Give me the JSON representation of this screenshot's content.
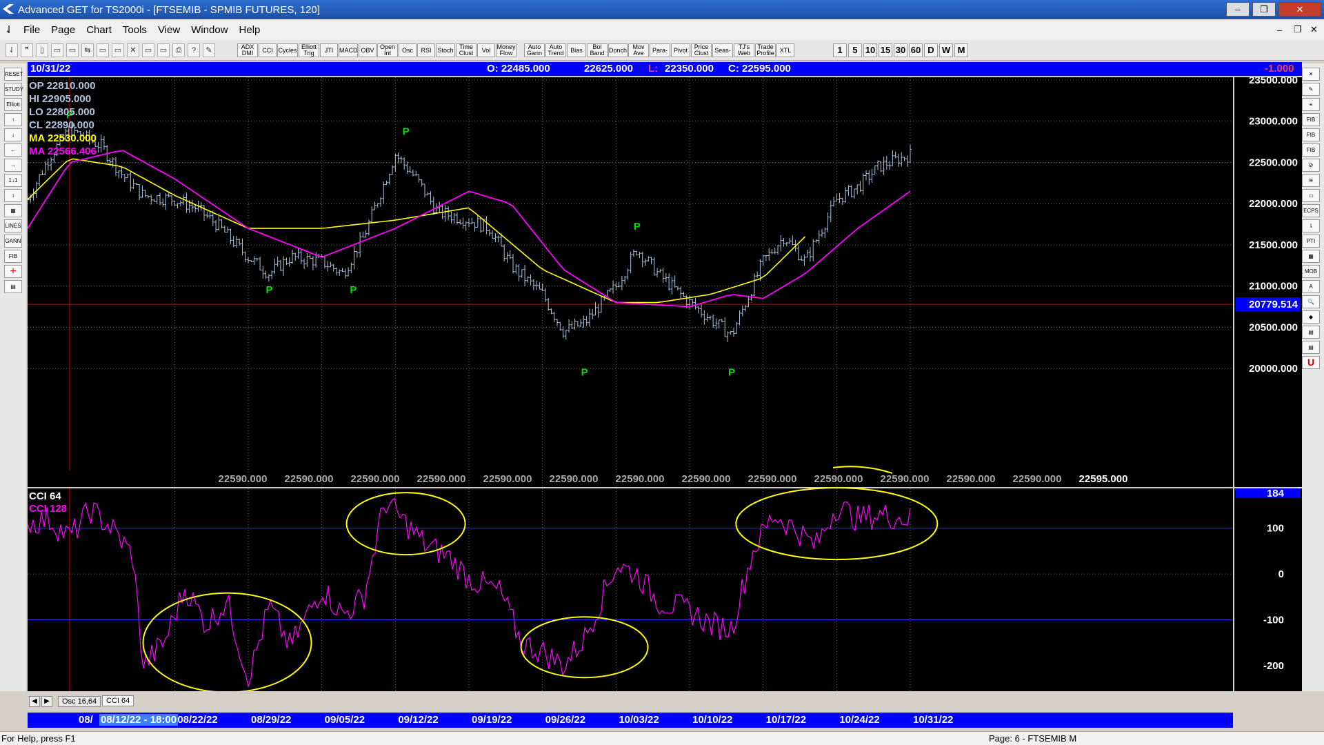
{
  "window": {
    "title": "Advanced GET for TS2000i - [FTSEMIB - SPMIB FUTURES, 120]",
    "controls": [
      "‒",
      "❐",
      "✕"
    ]
  },
  "menu": [
    "File",
    "Page",
    "Chart",
    "Tools",
    "View",
    "Window",
    "Help"
  ],
  "toolbar": {
    "indicators": [
      "ADX DMI",
      "CCI",
      "Cycles",
      "Elliott Trig",
      "JTI",
      "MACD",
      "OBV",
      "Open Int",
      "Osc",
      "RSI",
      "Stoch",
      "Time Clust",
      "Vol",
      "Money Flow",
      "Auto Gann",
      "Auto Trend",
      "Bias",
      "Bol Band",
      "Donch",
      "Mov Ave",
      "Para-bolic",
      "Pivot",
      "Price Clust",
      "Seas-onals",
      "TJ's Web",
      "Trade Profile",
      "XTL"
    ],
    "intervals": [
      "1",
      "5",
      "10",
      "15",
      "30",
      "60",
      "D",
      "W",
      "M"
    ]
  },
  "left_tools": [
    "RESET",
    "STUDY",
    "Elliott",
    "↑",
    "↓",
    "←",
    "→",
    "1↓1",
    "↕",
    "▦",
    "LINES",
    "GANN",
    "FIB",
    "+",
    "▤"
  ],
  "right_tools": [
    "✕",
    "✎",
    "≡",
    "FIB RET",
    "FIB EXT",
    "FIB TIME",
    "⊘",
    "≋",
    "▭",
    "ECPS",
    "⇂",
    "PTI",
    "▦",
    "MOB",
    "A",
    "🔍",
    "◆",
    "▤",
    "▤",
    "U"
  ],
  "info_bar": {
    "date": "10/31/22",
    "open": "O: 22485.000",
    "high": "22625.000",
    "low_label": "L:",
    "low": "22350.000",
    "close": "C: 22595.000",
    "change": "-1.000"
  },
  "legend": {
    "op": "OP 22810.000",
    "hi": "HI   22905.000",
    "lo": "LO  22805.000",
    "cl": "CL  22890.000",
    "ma": "MA  22530.000",
    "ma2": "MA  22566.406"
  },
  "price_axis": {
    "ticks": [
      "23500.000",
      "23000.000",
      "22500.000",
      "22000.000",
      "21500.000",
      "21000.000",
      "20500.000",
      "20000.000"
    ],
    "cursor_value": "20779.514",
    "row_values": [
      "22590.000",
      "22590.000",
      "22590.000",
      "22590.000",
      "22590.000",
      "22590.000",
      "22590.000",
      "22590.000",
      "22590.000",
      "22590.000",
      "22590.000",
      "22590.000",
      "22590.000",
      "22595.000"
    ]
  },
  "cci_panel": {
    "label1": "CCI 64",
    "label2": "CCI  128",
    "ticks": [
      "184",
      "100",
      "0",
      "-100",
      "-200"
    ]
  },
  "tabs": [
    "◀",
    "▶",
    "Osc 16,64",
    "CCI 64"
  ],
  "date_axis": {
    "cursor": "08/12/22 - 18:00",
    "dates": [
      "08/",
      "08/22/22",
      "08/29/22",
      "09/05/22",
      "09/12/22",
      "09/19/22",
      "09/26/22",
      "10/03/22",
      "10/10/22",
      "10/17/22",
      "10/24/22",
      "10/31/22"
    ]
  },
  "status": {
    "help": "For Help, press F1",
    "page": "Page: 6 - FTSEMIB M"
  },
  "colors": {
    "background": "#000000",
    "bars": "#b0c4de",
    "ma_yellow": "#ffff00",
    "ma_magenta": "#ff00ff",
    "pivot_green": "#00dd00",
    "info_blue": "#0000ff",
    "cci_line": "#ff00ff",
    "annotation": "#ffff00"
  },
  "chart_data": {
    "type": "candlestick",
    "timeframe": "120",
    "symbol": "FTSEMIB - SPMIB FUTURES",
    "y_range": [
      19600,
      23500
    ],
    "x_range": [
      "08/08/22",
      "10/31/22"
    ],
    "price_path": [
      [
        "08/08/22",
        22050
      ],
      [
        "08/10/22",
        22550
      ],
      [
        "08/12/22",
        22900
      ],
      [
        "08/15/22",
        22700
      ],
      [
        "08/17/22",
        22350
      ],
      [
        "08/19/22",
        22100
      ],
      [
        "08/22/22",
        22050
      ],
      [
        "08/24/22",
        21950
      ],
      [
        "08/26/22",
        21750
      ],
      [
        "08/29/22",
        21350
      ],
      [
        "08/31/22",
        21150
      ],
      [
        "09/02/22",
        21350
      ],
      [
        "09/05/22",
        21300
      ],
      [
        "09/07/22",
        21150
      ],
      [
        "09/09/22",
        21600
      ],
      [
        "09/12/22",
        22600
      ],
      [
        "09/14/22",
        22300
      ],
      [
        "09/16/22",
        21900
      ],
      [
        "09/19/22",
        21800
      ],
      [
        "09/21/22",
        21700
      ],
      [
        "09/23/22",
        21250
      ],
      [
        "09/26/22",
        20900
      ],
      [
        "09/28/22",
        20450
      ],
      [
        "09/30/22",
        20550
      ],
      [
        "10/03/22",
        21000
      ],
      [
        "10/05/22",
        21450
      ],
      [
        "10/07/22",
        21150
      ],
      [
        "10/10/22",
        20800
      ],
      [
        "10/12/22",
        20600
      ],
      [
        "10/14/22",
        20400
      ],
      [
        "10/17/22",
        21300
      ],
      [
        "10/19/22",
        21600
      ],
      [
        "10/21/22",
        21300
      ],
      [
        "10/24/22",
        22050
      ],
      [
        "10/26/22",
        22200
      ],
      [
        "10/28/22",
        22450
      ],
      [
        "10/31/22",
        22595
      ]
    ],
    "ma_yellow_path": [
      [
        "08/08/22",
        22050
      ],
      [
        "08/12/22",
        22550
      ],
      [
        "08/17/22",
        22450
      ],
      [
        "08/22/22",
        22100
      ],
      [
        "08/29/22",
        21700
      ],
      [
        "09/05/22",
        21700
      ],
      [
        "09/12/22",
        21800
      ],
      [
        "09/19/22",
        21950
      ],
      [
        "09/26/22",
        21200
      ],
      [
        "10/03/22",
        20800
      ],
      [
        "10/07/22",
        20800
      ],
      [
        "10/12/22",
        20900
      ],
      [
        "10/17/22",
        21100
      ],
      [
        "10/21/22",
        21600
      ]
    ],
    "ma_magenta_path": [
      [
        "08/08/22",
        21700
      ],
      [
        "08/12/22",
        22500
      ],
      [
        "08/17/22",
        22650
      ],
      [
        "08/22/22",
        22300
      ],
      [
        "08/29/22",
        21700
      ],
      [
        "09/05/22",
        21350
      ],
      [
        "09/12/22",
        21700
      ],
      [
        "09/19/22",
        22150
      ],
      [
        "09/23/22",
        22000
      ],
      [
        "09/28/22",
        21200
      ],
      [
        "10/03/22",
        20800
      ],
      [
        "10/10/22",
        20750
      ],
      [
        "10/14/22",
        20900
      ],
      [
        "10/17/22",
        20850
      ],
      [
        "10/21/22",
        21150
      ],
      [
        "10/26/22",
        21700
      ],
      [
        "10/31/22",
        22150
      ]
    ],
    "pivots": [
      {
        "label": "P",
        "date": "08/12/22",
        "price": 22950,
        "pos": "top"
      },
      {
        "label": "P",
        "date": "08/31/22",
        "price": 21100,
        "pos": "bottom"
      },
      {
        "label": "P",
        "date": "09/08/22",
        "price": 21100,
        "pos": "bottom"
      },
      {
        "label": "P",
        "date": "09/13/22",
        "price": 22750,
        "pos": "top"
      },
      {
        "label": "P",
        "date": "09/30/22",
        "price": 20100,
        "pos": "bottom"
      },
      {
        "label": "P",
        "date": "10/05/22",
        "price": 21600,
        "pos": "top"
      },
      {
        "label": "P",
        "date": "10/14/22",
        "price": 20100,
        "pos": "bottom"
      }
    ],
    "cursor_price": 20779.514,
    "cci": {
      "y_range": [
        -250,
        184
      ],
      "levels": [
        100,
        -100
      ],
      "path": [
        [
          "08/08/22",
          110
        ],
        [
          "08/10/22",
          120
        ],
        [
          "08/12/22",
          80
        ],
        [
          "08/14/22",
          140
        ],
        [
          "08/16/22",
          100
        ],
        [
          "08/18/22",
          40
        ],
        [
          "08/19/22",
          -200
        ],
        [
          "08/21/22",
          -150
        ],
        [
          "08/23/22",
          -30
        ],
        [
          "08/25/22",
          -110
        ],
        [
          "08/27/22",
          -60
        ],
        [
          "08/29/22",
          -230
        ],
        [
          "08/31/22",
          -70
        ],
        [
          "09/02/22",
          -160
        ],
        [
          "09/05/22",
          -30
        ],
        [
          "09/07/22",
          -90
        ],
        [
          "09/09/22",
          -50
        ],
        [
          "09/11/22",
          160
        ],
        [
          "09/13/22",
          110
        ],
        [
          "09/15/22",
          60
        ],
        [
          "09/17/22",
          40
        ],
        [
          "09/19/22",
          -10
        ],
        [
          "09/22/22",
          -40
        ],
        [
          "09/24/22",
          -150
        ],
        [
          "09/26/22",
          -170
        ],
        [
          "09/28/22",
          -200
        ],
        [
          "09/30/22",
          -140
        ],
        [
          "10/03/22",
          20
        ],
        [
          "10/05/22",
          0
        ],
        [
          "10/07/22",
          -60
        ],
        [
          "10/10/22",
          -80
        ],
        [
          "10/12/22",
          -110
        ],
        [
          "10/14/22",
          -120
        ],
        [
          "10/16/22",
          50
        ],
        [
          "10/18/22",
          130
        ],
        [
          "10/20/22",
          100
        ],
        [
          "10/22/22",
          60
        ],
        [
          "10/24/22",
          150
        ],
        [
          "10/26/22",
          120
        ],
        [
          "10/28/22",
          130
        ],
        [
          "10/31/22",
          120
        ]
      ]
    }
  }
}
